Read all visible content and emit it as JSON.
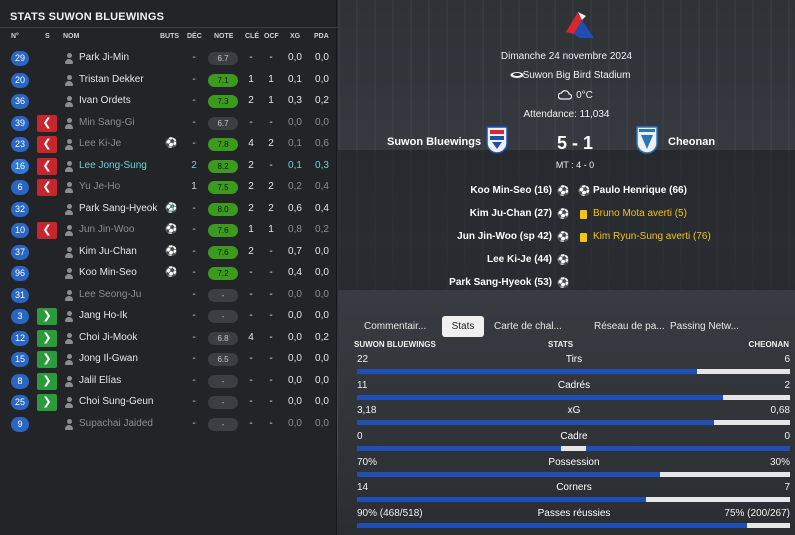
{
  "left": {
    "title": "STATS SUWON BLUEWINGS",
    "headers": {
      "num": "N°",
      "s": "S",
      "nom": "NOM",
      "buts": "BUTS",
      "dec": "DÉC",
      "note": "NOTE",
      "cle": "CLÉ",
      "ocf": "OCF",
      "xg": "XG",
      "pda": "PDA"
    },
    "players": [
      {
        "num": "29",
        "s": "",
        "name": "Park Ji-Min",
        "ball": false,
        "buts": "",
        "dec": "-",
        "note": "6.7",
        "note_good": false,
        "cle": "-",
        "ocf": "-",
        "xg": "0,0",
        "pda": "0,0",
        "state": ""
      },
      {
        "num": "20",
        "s": "",
        "name": "Tristan Dekker",
        "ball": false,
        "buts": "",
        "dec": "-",
        "note": "7.1",
        "note_good": true,
        "cle": "1",
        "ocf": "1",
        "xg": "0,1",
        "pda": "0,0",
        "state": ""
      },
      {
        "num": "36",
        "s": "",
        "name": "Ivan Ordets",
        "ball": false,
        "buts": "",
        "dec": "-",
        "note": "7.3",
        "note_good": true,
        "cle": "2",
        "ocf": "1",
        "xg": "0,3",
        "pda": "0,2",
        "state": ""
      },
      {
        "num": "39",
        "s": "out",
        "name": "Min Sang-Gi",
        "ball": false,
        "buts": "",
        "dec": "-",
        "note": "6.7",
        "note_good": false,
        "cle": "-",
        "ocf": "-",
        "xg": "0,0",
        "pda": "0,0",
        "state": "sub"
      },
      {
        "num": "23",
        "s": "out",
        "name": "Lee Ki-Je",
        "ball": true,
        "buts": "",
        "dec": "-",
        "note": "7.8",
        "note_good": true,
        "cle": "4",
        "ocf": "2",
        "xg": "0,1",
        "pda": "0,6",
        "state": "sub"
      },
      {
        "num": "16",
        "s": "out",
        "name": "Lee Jong-Sung",
        "ball": false,
        "buts": "",
        "dec": "2",
        "note": "8.2",
        "note_good": true,
        "cle": "2",
        "ocf": "-",
        "xg": "0,1",
        "pda": "0,3",
        "state": "sel"
      },
      {
        "num": "6",
        "s": "out",
        "name": "Yu Je-Ho",
        "ball": false,
        "buts": "",
        "dec": "1",
        "note": "7.5",
        "note_good": true,
        "cle": "2",
        "ocf": "2",
        "xg": "0,2",
        "pda": "0,4",
        "state": "sub"
      },
      {
        "num": "32",
        "s": "",
        "name": "Park Sang-Hyeok",
        "ball": true,
        "buts": "1",
        "dec": "-",
        "note": "8.0",
        "note_good": true,
        "cle": "2",
        "ocf": "2",
        "xg": "0,6",
        "pda": "0,4",
        "state": ""
      },
      {
        "num": "10",
        "s": "out",
        "name": "Jun Jin-Woo",
        "ball": true,
        "buts": "",
        "dec": "-",
        "note": "7.6",
        "note_good": true,
        "cle": "1",
        "ocf": "1",
        "xg": "0,8",
        "pda": "0,2",
        "state": "sub"
      },
      {
        "num": "37",
        "s": "",
        "name": "Kim Ju-Chan",
        "ball": true,
        "buts": "",
        "dec": "-",
        "note": "7.6",
        "note_good": true,
        "cle": "2",
        "ocf": "-",
        "xg": "0,7",
        "pda": "0,0",
        "state": ""
      },
      {
        "num": "96",
        "s": "",
        "name": "Koo Min-Seo",
        "ball": true,
        "buts": "",
        "dec": "-",
        "note": "7.2",
        "note_good": true,
        "cle": "-",
        "ocf": "-",
        "xg": "0,4",
        "pda": "0,0",
        "state": ""
      },
      {
        "num": "31",
        "s": "",
        "name": "Lee Seong-Ju",
        "ball": false,
        "buts": "",
        "dec": "-",
        "note": "-",
        "note_good": false,
        "cle": "-",
        "ocf": "-",
        "xg": "0,0",
        "pda": "0,0",
        "state": "sub"
      },
      {
        "num": "3",
        "s": "in",
        "name": "Jang Ho-Ik",
        "ball": false,
        "buts": "",
        "dec": "-",
        "note": "-",
        "note_good": false,
        "cle": "-",
        "ocf": "-",
        "xg": "0,0",
        "pda": "0,0",
        "state": ""
      },
      {
        "num": "12",
        "s": "in",
        "name": "Choi Ji-Mook",
        "ball": false,
        "buts": "",
        "dec": "-",
        "note": "6.8",
        "note_good": false,
        "cle": "4",
        "ocf": "-",
        "xg": "0,0",
        "pda": "0,2",
        "state": ""
      },
      {
        "num": "15",
        "s": "in",
        "name": "Jong Il-Gwan",
        "ball": false,
        "buts": "",
        "dec": "-",
        "note": "6.5",
        "note_good": false,
        "cle": "-",
        "ocf": "-",
        "xg": "0,0",
        "pda": "0,0",
        "state": ""
      },
      {
        "num": "8",
        "s": "in",
        "name": "Jalil Elías",
        "ball": false,
        "buts": "",
        "dec": "-",
        "note": "-",
        "note_good": false,
        "cle": "-",
        "ocf": "-",
        "xg": "0,0",
        "pda": "0,0",
        "state": ""
      },
      {
        "num": "25",
        "s": "in",
        "name": "Choi Sung-Geun",
        "ball": false,
        "buts": "",
        "dec": "-",
        "note": "-",
        "note_good": false,
        "cle": "-",
        "ocf": "-",
        "xg": "0,0",
        "pda": "0,0",
        "state": ""
      },
      {
        "num": "9",
        "s": "",
        "name": "Supachai Jaided",
        "ball": false,
        "buts": "",
        "dec": "-",
        "note": "-",
        "note_good": false,
        "cle": "-",
        "ocf": "-",
        "xg": "0,0",
        "pda": "0,0",
        "state": "sub"
      }
    ]
  },
  "match": {
    "date": "Dimanche 24 novembre 2024",
    "stadium": "Suwon Big Bird Stadium",
    "weather": "0°C",
    "attendance": "Attendance: 11,034",
    "home_team": "Suwon Bluewings",
    "away_team": "Cheonan",
    "score": "5 - 1",
    "halftime": "MT : 4 - 0",
    "home_events": [
      "Koo Min-Seo (16)",
      "Kim Ju-Chan (27)",
      "Jun Jin-Woo (sp 42)",
      "Lee Ki-Je (44)",
      "Park Sang-Hyeok (53)"
    ],
    "away_events": [
      {
        "text": "Paulo Henrique (66)",
        "type": "goal"
      },
      {
        "text": "Bruno Mota averti (5)",
        "type": "yellow"
      },
      {
        "text": "Kim Ryun-Sung averti (76)",
        "type": "yellow"
      }
    ]
  },
  "tabs": [
    "Commentair...",
    "Stats",
    "Carte de chal...",
    "Réseau de pa...",
    "Passing Netw..."
  ],
  "stats_header": {
    "home": "SUWON BLUEWINGS",
    "mid": "STATS",
    "away": "CHEONAN"
  },
  "stats": [
    {
      "label": "Tirs",
      "home": "22",
      "away": "6",
      "home_share": 0.786
    },
    {
      "label": "Cadrés",
      "home": "11",
      "away": "2",
      "home_share": 0.846
    },
    {
      "label": "xG",
      "home": "3,18",
      "away": "0,68",
      "home_share": 0.824
    },
    {
      "label": "Cadre",
      "home": "0",
      "away": "0",
      "home_share": 0.5
    },
    {
      "label": "Possession",
      "home": "70%",
      "away": "30%",
      "home_share": 0.7
    },
    {
      "label": "Corners",
      "home": "14",
      "away": "7",
      "home_share": 0.667
    },
    {
      "label": "Passes réussies",
      "home": "90% (468/518)",
      "away": "75% (200/267)",
      "home_share": 0.9
    }
  ],
  "colors": {
    "accent_blue": "#2a66c4",
    "note_green": "#3c9b1f",
    "sub_out_red": "#c7262c",
    "sub_in_green": "#2a9a3a",
    "card_yellow": "#f2c318",
    "selected_cyan": "#6fd0d0"
  }
}
